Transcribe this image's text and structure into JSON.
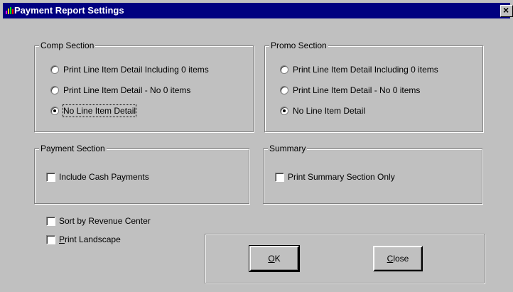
{
  "window": {
    "title": "Payment Report Settings",
    "close_glyph": "×"
  },
  "comp": {
    "label": "Comp Section",
    "options": [
      {
        "label": "Print Line Item Detail  Including 0 items",
        "selected": false
      },
      {
        "label": "Print Line Item Detail - No 0 items",
        "selected": false
      },
      {
        "label": "No Line Item Detail",
        "selected": true
      }
    ]
  },
  "promo": {
    "label": "Promo Section",
    "options": [
      {
        "label": "Print Line Item Detail  Including 0 items",
        "selected": false
      },
      {
        "label": "Print Line Item Detail - No 0 items",
        "selected": false
      },
      {
        "label": "No Line Item Detail",
        "selected": true
      }
    ]
  },
  "payment": {
    "label": "Payment Section",
    "include_cash": "Include Cash Payments"
  },
  "summary": {
    "label": "Summary",
    "print_summary_only": "Print Summary Section Only"
  },
  "options": {
    "sort_by_revenue": "Sort by Revenue Center",
    "print_landscape_first": "P",
    "print_landscape_rest": "rint Landscape"
  },
  "buttons": {
    "ok_first": "O",
    "ok_rest": "K",
    "close_first": "C",
    "close_rest": "lose"
  }
}
